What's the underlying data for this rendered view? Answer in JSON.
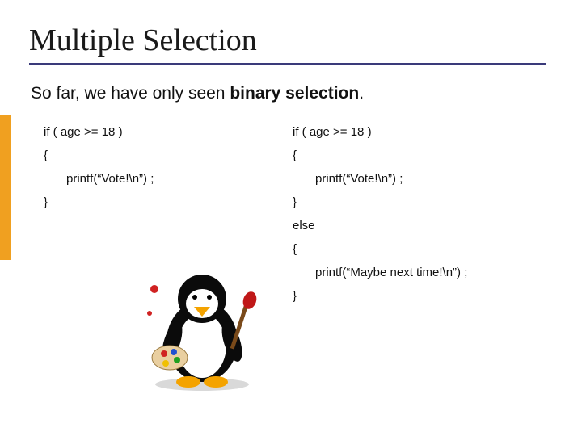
{
  "title": "Multiple Selection",
  "subtitle_plain": "So far, we have only seen ",
  "subtitle_bold": "binary selection",
  "subtitle_tail": ".",
  "left": {
    "l1": "if ( age >= 18 )",
    "l2": "{",
    "l3": "printf(“Vote!\\n”) ;",
    "l4": "}"
  },
  "right": {
    "r1": "if ( age >= 18 )",
    "r2": "{",
    "r3": "printf(“Vote!\\n”) ;",
    "r4": "}",
    "r5": "else",
    "r6": "{",
    "r7": "printf(“Maybe next time!\\n”) ;",
    "r8": "}"
  },
  "icon": "penguin-painter-icon"
}
